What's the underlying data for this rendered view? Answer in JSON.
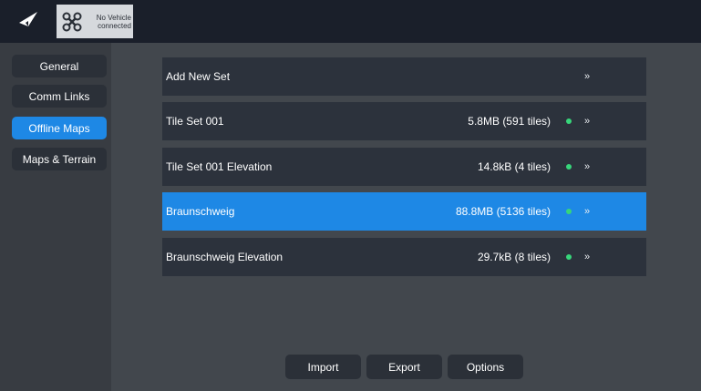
{
  "toolbar": {
    "back_icon": "paper-plane-icon",
    "vehicle_icon": "drone-icon",
    "vehicle_status_line1": "No Vehicle",
    "vehicle_status_line2": "connected"
  },
  "sidebar": {
    "items": [
      {
        "label": "General",
        "active": false
      },
      {
        "label": "Comm Links",
        "active": false
      },
      {
        "label": "Offline Maps",
        "active": true
      },
      {
        "label": "Maps & Terrain",
        "active": false
      }
    ]
  },
  "tile_sets": {
    "rows": [
      {
        "name": "Add New Set",
        "size": "",
        "status": ""
      },
      {
        "name": "Tile Set 001",
        "size": "5.8MB (591 tiles)",
        "status": "complete"
      },
      {
        "name": "Tile Set 001 Elevation",
        "size": "14.8kB (4 tiles)",
        "status": "complete"
      },
      {
        "name": "Braunschweig",
        "size": "88.8MB (5136 tiles)",
        "status": "complete",
        "selected": true
      },
      {
        "name": "Braunschweig Elevation",
        "size": "29.7kB (8 tiles)",
        "status": "complete"
      }
    ],
    "chevron": "»"
  },
  "actions": {
    "import_label": "Import",
    "export_label": "Export",
    "options_label": "Options"
  },
  "colors": {
    "accent": "#1e88e5",
    "status_ok": "#37d67a",
    "toolbar_bg": "#1a1f2a",
    "row_bg": "#2c323c"
  }
}
